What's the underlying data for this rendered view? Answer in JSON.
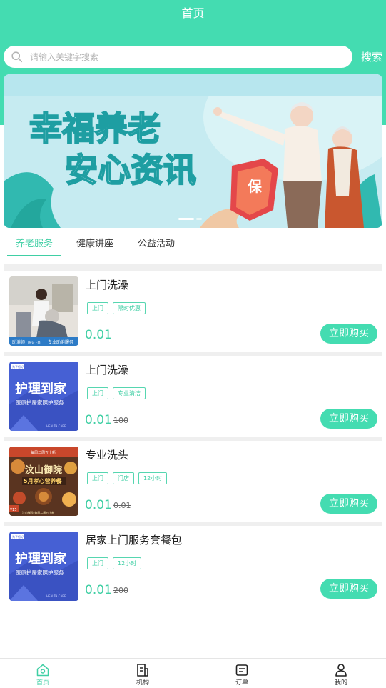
{
  "header": {
    "title": "首页"
  },
  "search": {
    "placeholder": "请输入关键字搜索",
    "button": "搜索"
  },
  "banner": {
    "line1": "幸福养老",
    "line2": "安心资讯",
    "badge": "保"
  },
  "tabs": [
    {
      "label": "养老服务",
      "active": true
    },
    {
      "label": "健康讲座",
      "active": false
    },
    {
      "label": "公益活动",
      "active": false
    }
  ],
  "products": [
    {
      "title": "上门洗澡",
      "tags": [
        "上门",
        "限时优惠"
      ],
      "price": "0.01",
      "old_price": "",
      "buy": "立即购买",
      "thumb": {
        "caption": "助浴师",
        "caption_small": "(持证上岗)",
        "caption_right": "专业助浴服务"
      }
    },
    {
      "title": "上门洗澡",
      "tags": [
        "上门",
        "专业清洁"
      ],
      "price": "0.01",
      "old_price": "100",
      "buy": "立即购买",
      "thumb": {
        "corner": "为了您好",
        "headline": "护理到家",
        "sub": "医康护居家照护服务",
        "foot": "HEALTH CARE"
      }
    },
    {
      "title": "专业洗头",
      "tags": [
        "上门",
        "门店",
        "12小时"
      ],
      "price": "0.01",
      "old_price": "0.01",
      "buy": "立即购买",
      "thumb": {
        "top": "每周二周五上新",
        "headline": "汶山御院",
        "sub": "5月孝心营养餐",
        "price": "¥15",
        "foot": "汶山御院 每周二周五上新"
      }
    },
    {
      "title": "居家上门服务套餐包",
      "tags": [
        "上门",
        "12小时"
      ],
      "price": "0.01",
      "old_price": "200",
      "buy": "立即购买",
      "thumb": {
        "corner": "为了您好",
        "headline": "护理到家",
        "sub": "医康护居家照护服务",
        "foot": "HEALTH CARE"
      }
    }
  ],
  "tabbar": [
    {
      "label": "首页",
      "icon": "home-icon",
      "active": true
    },
    {
      "label": "机构",
      "icon": "document-icon",
      "active": false
    },
    {
      "label": "订单",
      "icon": "order-icon",
      "active": false
    },
    {
      "label": "我的",
      "icon": "user-icon",
      "active": false
    }
  ],
  "colors": {
    "brand": "#44dcb1",
    "accent_text": "#3fcfa4",
    "separator": "#efefef"
  }
}
